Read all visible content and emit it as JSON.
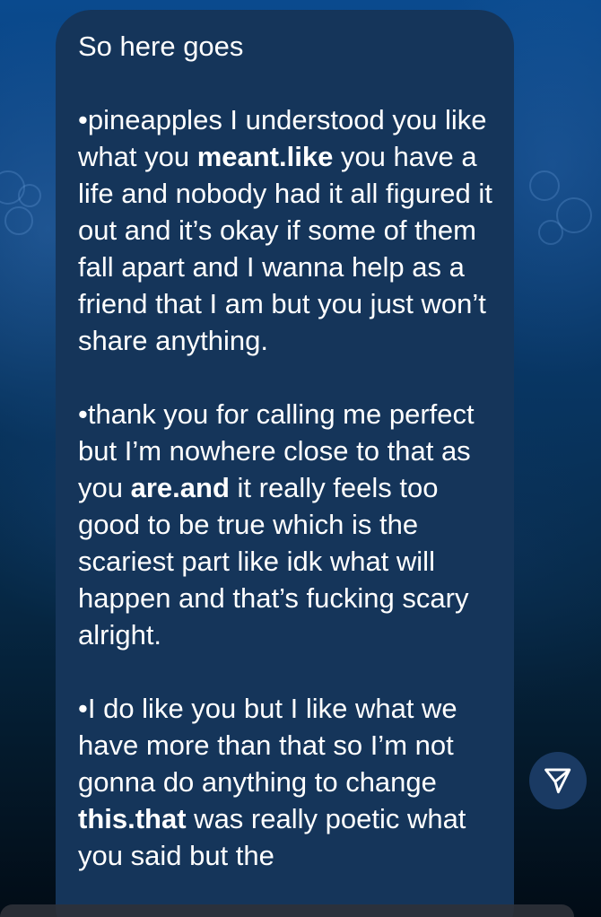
{
  "message": {
    "paragraphs": [
      {
        "segments": [
          {
            "text": "So here goes",
            "bold": false
          }
        ]
      },
      {
        "segments": [
          {
            "text": "•pineapples I understood you like what you ",
            "bold": false
          },
          {
            "text": "meant.like",
            "bold": true
          },
          {
            "text": " you have a life and nobody had it all figured it out and it’s okay if some of them fall apart and I wanna help as a friend that I am but you just won’t share anything.",
            "bold": false
          }
        ]
      },
      {
        "segments": [
          {
            "text": "•thank you for calling me perfect but I’m nowhere close to that as you ",
            "bold": false
          },
          {
            "text": "are.and",
            "bold": true
          },
          {
            "text": " it really feels too good to be true which is the scariest part like idk what will happen and that’s fucking scary alright.",
            "bold": false
          }
        ]
      },
      {
        "segments": [
          {
            "text": "•I do like you but I like what we have more than that so I’m not gonna do anything to change ",
            "bold": false
          },
          {
            "text": "this.that",
            "bold": true
          },
          {
            "text": " was really poetic what you said but the",
            "bold": false
          }
        ]
      }
    ]
  },
  "send_button": {
    "icon": "send-icon"
  },
  "colors": {
    "bubble": "#15355a",
    "text": "#ffffff",
    "send_button": "#1a3a63"
  }
}
